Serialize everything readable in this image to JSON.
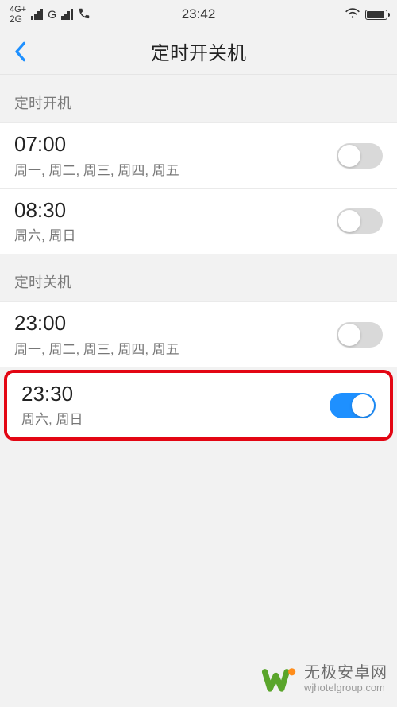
{
  "status": {
    "net1_top": "4G+",
    "net1_bottom": "2G",
    "net2": "G",
    "time": "23:42"
  },
  "page": {
    "title": "定时开关机"
  },
  "sections": {
    "on": {
      "header": "定时开机"
    },
    "off": {
      "header": "定时关机"
    }
  },
  "items": {
    "on1": {
      "time": "07:00",
      "days": "周一, 周二, 周三, 周四, 周五",
      "enabled": false
    },
    "on2": {
      "time": "08:30",
      "days": "周六, 周日",
      "enabled": false
    },
    "off1": {
      "time": "23:00",
      "days": "周一, 周二, 周三, 周四, 周五",
      "enabled": false
    },
    "off2": {
      "time": "23:30",
      "days": "周六, 周日",
      "enabled": true
    }
  },
  "watermark": {
    "cn": "无极安卓网",
    "en": "wjhotelgroup.com"
  }
}
